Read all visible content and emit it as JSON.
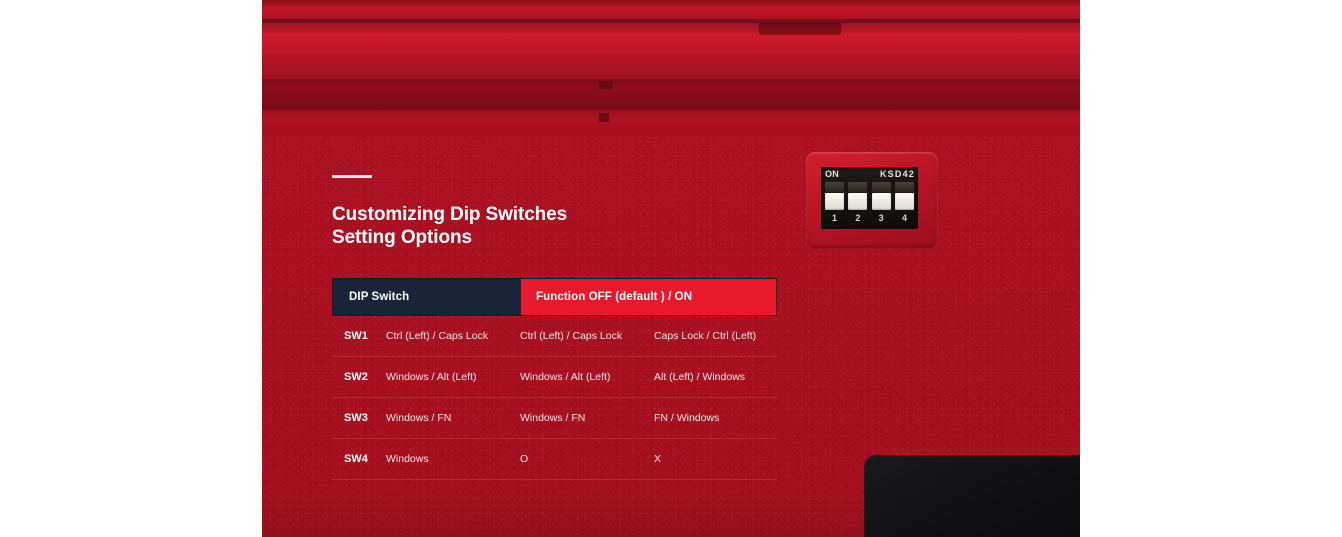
{
  "panel": {
    "background_color": "#ad1122",
    "accent_red": "#e8192a",
    "header_navy": "#1b2438"
  },
  "heading": {
    "line1": "Customizing Dip Switches",
    "line2": "Setting Options"
  },
  "table": {
    "headers": {
      "left": "DIP Switch",
      "right": "Function OFF (default ) / ON"
    },
    "rows": [
      {
        "switch": "SW1",
        "function": "Ctrl (Left) / Caps Lock",
        "off": "Ctrl (Left) / Caps Lock",
        "on": "Caps Lock / Ctrl (Left)"
      },
      {
        "switch": "SW2",
        "function": "Windows  / Alt (Left)",
        "off": "Windows / Alt (Left)",
        "on": "Alt (Left) / Windows"
      },
      {
        "switch": "SW3",
        "function": "Windows / FN",
        "off": "Windows / FN",
        "on": "FN / Windows"
      },
      {
        "switch": "SW4",
        "function": "Windows",
        "off": "O",
        "on": "X"
      }
    ]
  },
  "dip_module": {
    "on_label": "ON",
    "code_label": "KSD42",
    "numbers": [
      "1",
      "2",
      "3",
      "4"
    ],
    "switch_count": 4
  }
}
